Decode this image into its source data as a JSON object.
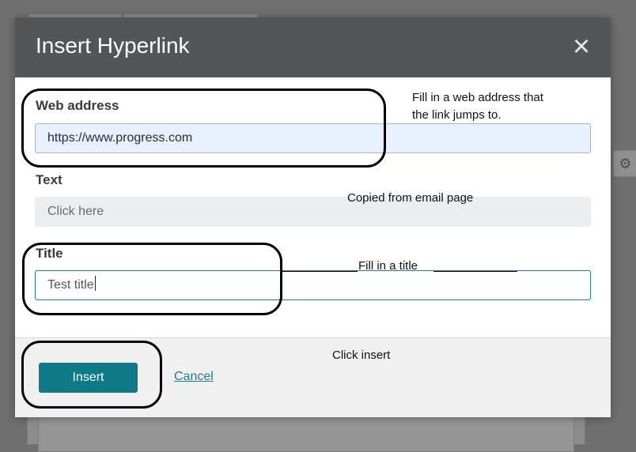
{
  "dialog": {
    "title": "Insert Hyperlink",
    "close_glyph": "×",
    "web_address": {
      "label": "Web address",
      "value": "https://www.progress.com"
    },
    "text": {
      "label": "Text",
      "value": "Click here"
    },
    "title_field": {
      "label": "Title",
      "value": "Test title"
    },
    "insert_label": "Insert",
    "cancel_label": "Cancel"
  },
  "annotations": {
    "web_note_line1": "Fill in a web address that",
    "web_note_line2": "the link jumps to.",
    "text_note": "Copied from email page",
    "title_note": "Fill in a title",
    "insert_note": "Click insert"
  },
  "background": {
    "gear_glyph": "⚙"
  },
  "icons": {
    "close": "close-icon",
    "gear": "gear-icon"
  },
  "colors": {
    "header": "#545556",
    "accent": "#0e7a87",
    "web_field": "#e8f0fe",
    "overlay": "#6f6f6f"
  }
}
